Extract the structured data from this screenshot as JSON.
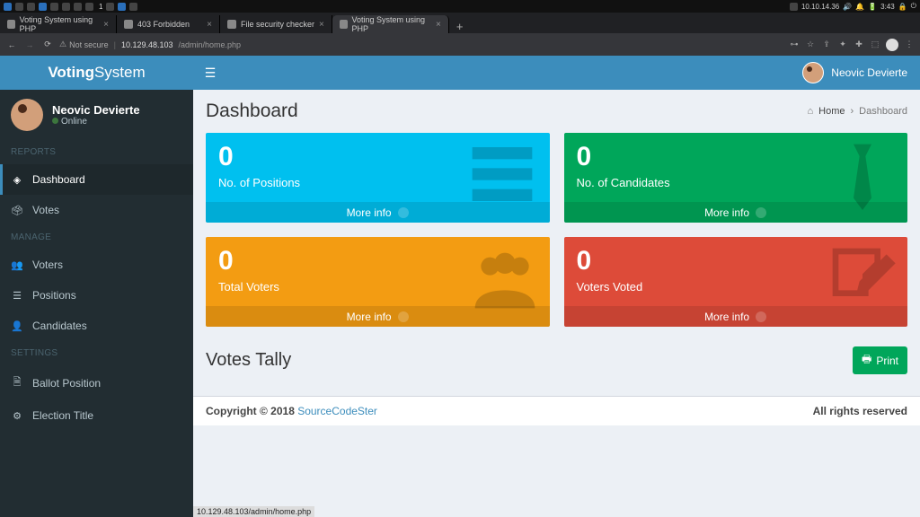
{
  "os": {
    "ip": "10.10.14.36",
    "time": "3:43"
  },
  "tabs": [
    {
      "label": "Voting System using PHP"
    },
    {
      "label": "403 Forbidden"
    },
    {
      "label": "File security checker"
    },
    {
      "label": "Voting System using PHP",
      "active": true
    }
  ],
  "url": {
    "secure_label": "Not secure",
    "host": "10.129.48.103",
    "path": "/admin/home.php"
  },
  "brand": {
    "bold": "Voting",
    "light": "System"
  },
  "header_user": "Neovic Devierte",
  "sidebar_user": {
    "name": "Neovic Devierte",
    "status": "Online"
  },
  "nav": {
    "reports_header": "REPORTS",
    "dashboard": "Dashboard",
    "votes": "Votes",
    "manage_header": "MANAGE",
    "voters": "Voters",
    "positions": "Positions",
    "candidates": "Candidates",
    "settings_header": "SETTINGS",
    "ballot": "Ballot Position",
    "election": "Election Title"
  },
  "page": {
    "title": "Dashboard",
    "crumb_home": "Home",
    "crumb_current": "Dashboard"
  },
  "boxes": {
    "positions": {
      "value": "0",
      "label": "No. of Positions",
      "footer": "More info"
    },
    "candidates": {
      "value": "0",
      "label": "No. of Candidates",
      "footer": "More info"
    },
    "voters": {
      "value": "0",
      "label": "Total Voters",
      "footer": "More info"
    },
    "voted": {
      "value": "0",
      "label": "Voters Voted",
      "footer": "More info"
    }
  },
  "tally_title": "Votes Tally",
  "print_label": "Print",
  "footer": {
    "copyright": "Copyright © 2018 ",
    "link": "SourceCodeSter",
    "rights": "All rights reserved"
  },
  "status_link": "10.129.48.103/admin/home.php"
}
